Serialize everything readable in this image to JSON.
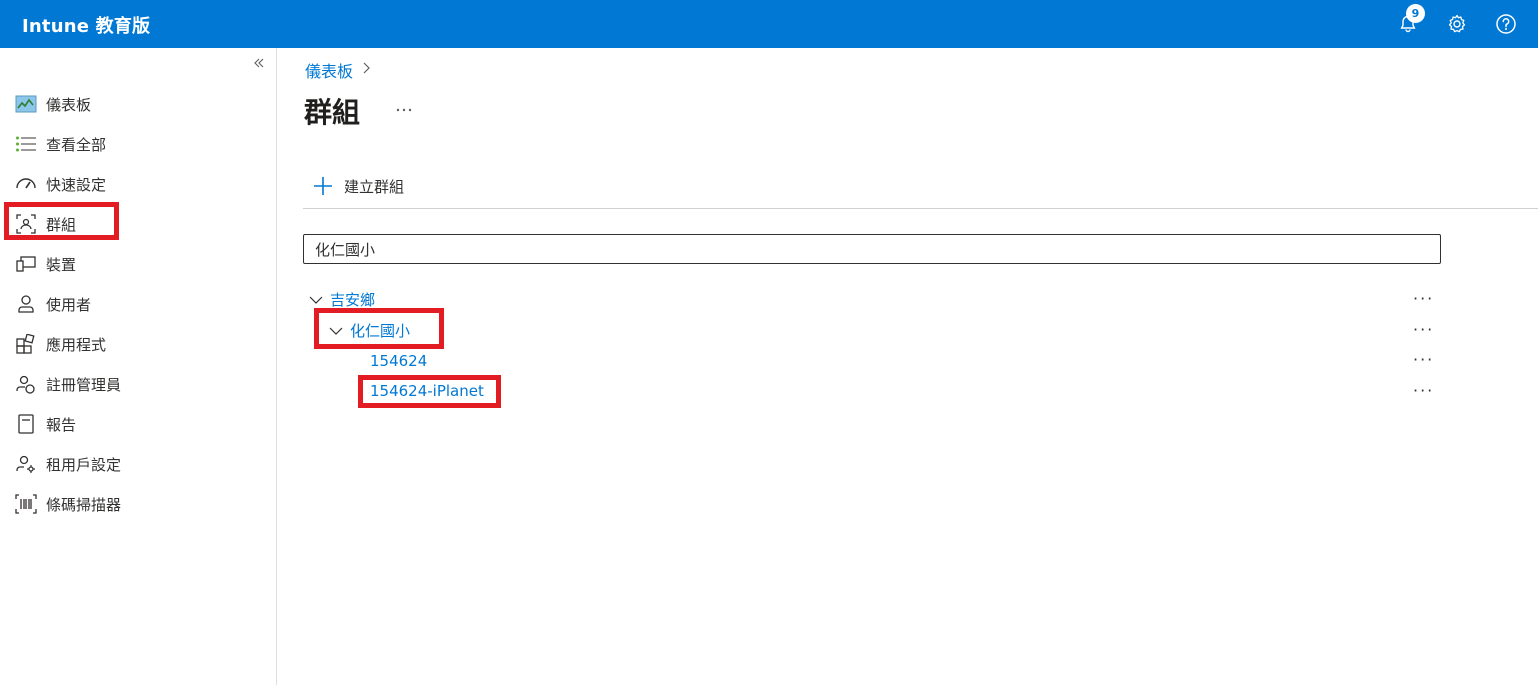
{
  "header": {
    "app_title": "Intune 教育版",
    "notification_count": "9"
  },
  "sidebar": {
    "items": [
      {
        "label": "儀表板",
        "icon": "dashboard-icon"
      },
      {
        "label": "查看全部",
        "icon": "list-icon"
      },
      {
        "label": "快速設定",
        "icon": "gauge-icon"
      },
      {
        "label": "群組",
        "icon": "groups-icon"
      },
      {
        "label": "裝置",
        "icon": "devices-icon"
      },
      {
        "label": "使用者",
        "icon": "user-icon"
      },
      {
        "label": "應用程式",
        "icon": "apps-icon"
      },
      {
        "label": "註冊管理員",
        "icon": "enrollment-manager-icon"
      },
      {
        "label": "報告",
        "icon": "report-icon"
      },
      {
        "label": "租用戶設定",
        "icon": "tenant-settings-icon"
      },
      {
        "label": "條碼掃描器",
        "icon": "barcode-icon"
      }
    ]
  },
  "main": {
    "breadcrumb": "儀表板",
    "title": "群組",
    "more": "...",
    "create_label": "建立群組",
    "search_value": "化仁國小",
    "tree": [
      {
        "label": "吉安鄉",
        "level": 0,
        "expanded": true
      },
      {
        "label": "化仁國小",
        "level": 1,
        "expanded": true
      },
      {
        "label": "154624",
        "level": 2
      },
      {
        "label": "154624-iPlanet",
        "level": 2
      }
    ],
    "row_more": "···"
  },
  "colors": {
    "accent": "#0078d4",
    "highlight": "#e31b23"
  }
}
